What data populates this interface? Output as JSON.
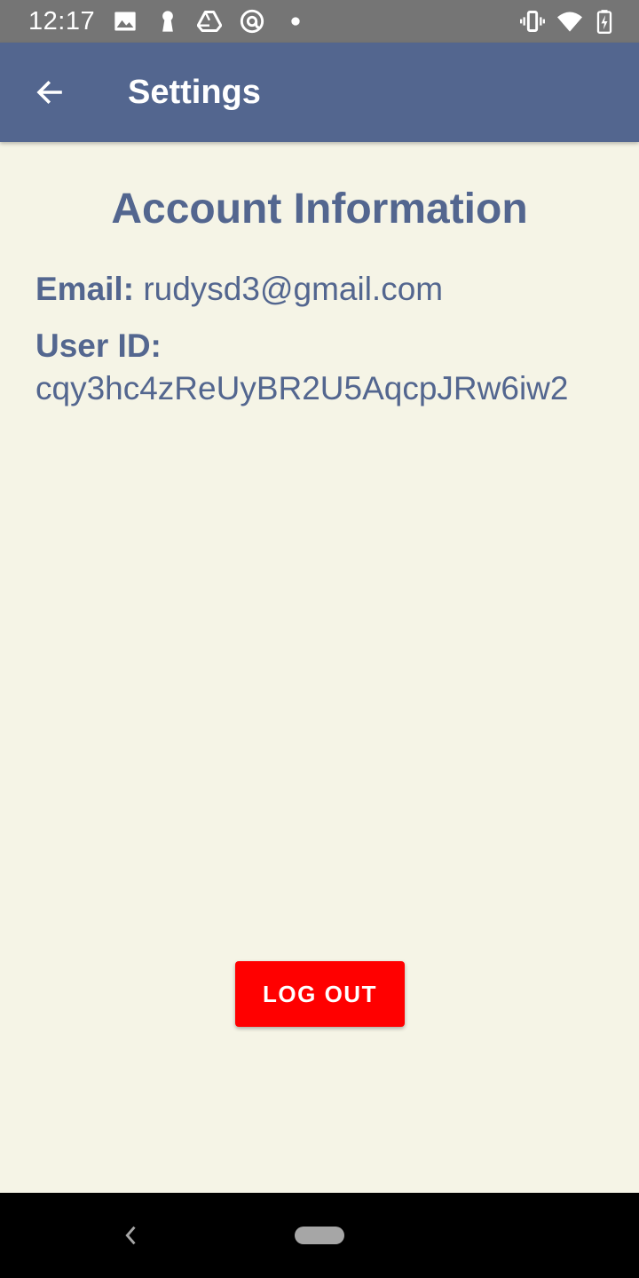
{
  "status_bar": {
    "time": "12:17",
    "left_icons": [
      "image-icon",
      "keyhole-icon",
      "drive-icon",
      "at-sign-icon",
      "dot-icon"
    ],
    "right_icons": [
      "vibrate-icon",
      "wifi-icon",
      "battery-charging-icon"
    ]
  },
  "app_bar": {
    "title": "Settings",
    "back_icon": "arrow-left-icon",
    "background": "#53668f"
  },
  "account": {
    "heading": "Account Information",
    "email_label": "Email:",
    "email_value": "rudysd3@gmail.com",
    "user_id_label": "User ID:",
    "user_id_value": "cqy3hc4zReUyBR2U5AqcpJRw6iw2"
  },
  "logout_button": {
    "label": "LOG OUT",
    "color": "#ff0000"
  },
  "nav_bar": {
    "back_icon": "chevron-left-icon",
    "home_icon": "home-pill-icon"
  },
  "colors": {
    "page_background": "#f5f4e6",
    "text_accent": "#53668f"
  }
}
